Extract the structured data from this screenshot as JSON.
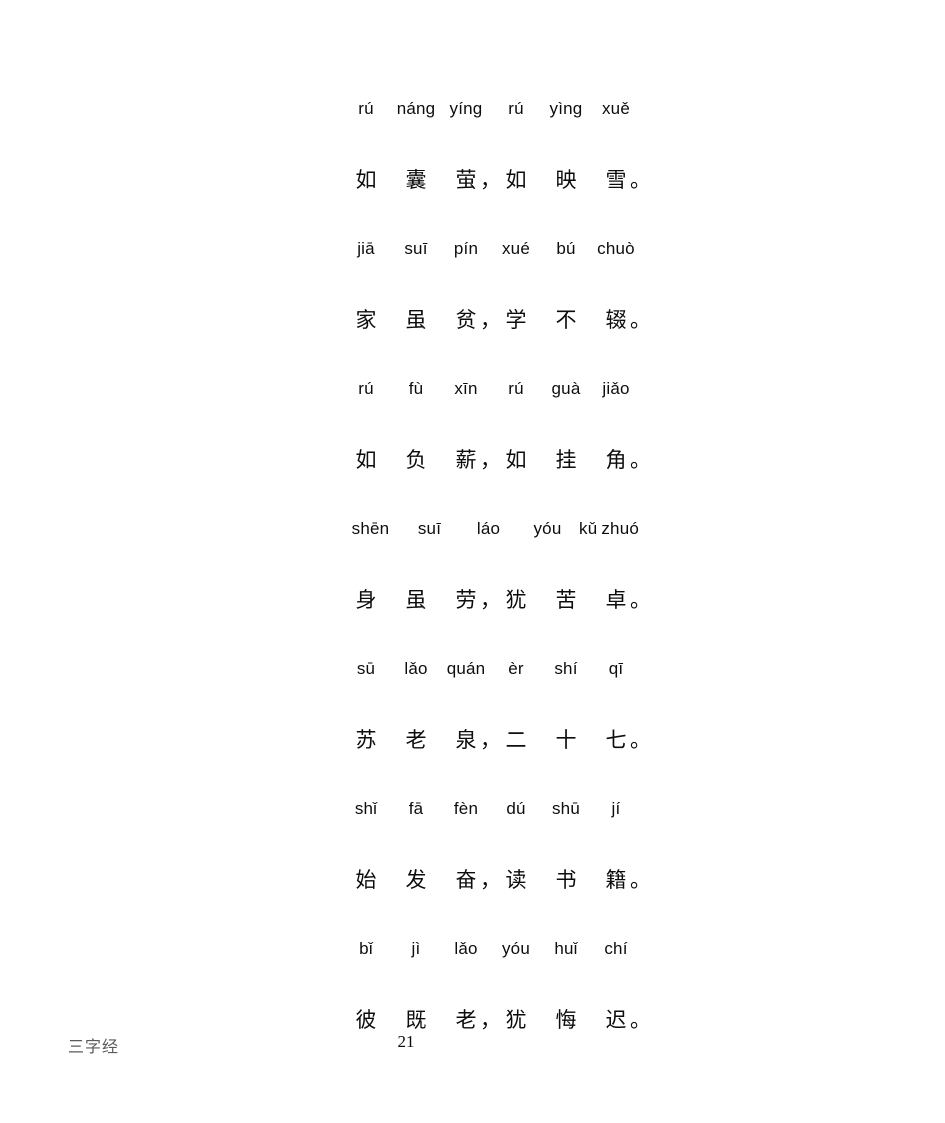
{
  "document": {
    "title": "三字经",
    "page_number": "21",
    "footer_label": "三字经",
    "background_color": "#ffffff",
    "text_color": "#0d0d0d",
    "footer_color": "#5a5a5a"
  },
  "verses": [
    {
      "pinyin": [
        "rú",
        "náng",
        "yíng",
        "rú",
        "yìng",
        "xuě"
      ],
      "hanzi": [
        "如",
        "囊",
        "萤",
        "如",
        "映",
        "雪"
      ],
      "punct_after_3": "，",
      "punct_after_6": "。",
      "text_hanzi": "如囊萤，如映雪。",
      "text_pinyin": "rú náng yíng, rú yìng xuě"
    },
    {
      "pinyin": [
        "jiā",
        "suī",
        "pín",
        "xué",
        "bú",
        "chuò"
      ],
      "hanzi": [
        "家",
        "虽",
        "贫",
        "学",
        "不",
        "辍"
      ],
      "punct_after_3": "，",
      "punct_after_6": "。",
      "text_hanzi": "家虽贫，学不辍。",
      "text_pinyin": "jiā suī pín, xué bú chuò"
    },
    {
      "pinyin": [
        "rú",
        "fù",
        "xīn",
        "rú",
        "guà",
        "jiǎo"
      ],
      "hanzi": [
        "如",
        "负",
        "薪",
        "如",
        "挂",
        "角"
      ],
      "punct_after_3": "，",
      "punct_after_6": "。",
      "text_hanzi": "如负薪，如挂角。",
      "text_pinyin": "rú fù xīn, rú guà jiǎo"
    },
    {
      "pinyin": [
        "shēn",
        "suī",
        "láo",
        "yóu",
        "kǔ",
        "zhuó"
      ],
      "hanzi": [
        "身",
        "虽",
        "劳",
        "犹",
        "苦",
        "卓"
      ],
      "punct_after_3": "，",
      "punct_after_6": "。",
      "text_hanzi": "身虽劳，犹苦卓。",
      "text_pinyin": "shēn suī láo, yóu kǔ zhuó"
    },
    {
      "pinyin": [
        "sū",
        "lǎo",
        "quán",
        "èr",
        "shí",
        "qī"
      ],
      "hanzi": [
        "苏",
        "老",
        "泉",
        "二",
        "十",
        "七"
      ],
      "punct_after_3": "，",
      "punct_after_6": "。",
      "text_hanzi": "苏老泉，二十七。",
      "text_pinyin": "sū lǎo quán, èr shí qī"
    },
    {
      "pinyin": [
        "shǐ",
        "fā",
        "fèn",
        "dú",
        "shū",
        "jí"
      ],
      "hanzi": [
        "始",
        "发",
        "奋",
        "读",
        "书",
        "籍"
      ],
      "punct_after_3": "，",
      "punct_after_6": "。",
      "text_hanzi": "始发奋，读书籍。",
      "text_pinyin": "shǐ fā fèn, dú shū jí"
    },
    {
      "pinyin": [
        "bǐ",
        "jì",
        "lǎo",
        "yóu",
        "huǐ",
        "chí"
      ],
      "hanzi": [
        "彼",
        "既",
        "老",
        "犹",
        "悔",
        "迟"
      ],
      "punct_after_3": "，",
      "punct_after_6": "。",
      "text_hanzi": "彼既老，犹悔迟。",
      "text_pinyin": "bǐ jì lǎo, yóu huǐ chí"
    }
  ]
}
